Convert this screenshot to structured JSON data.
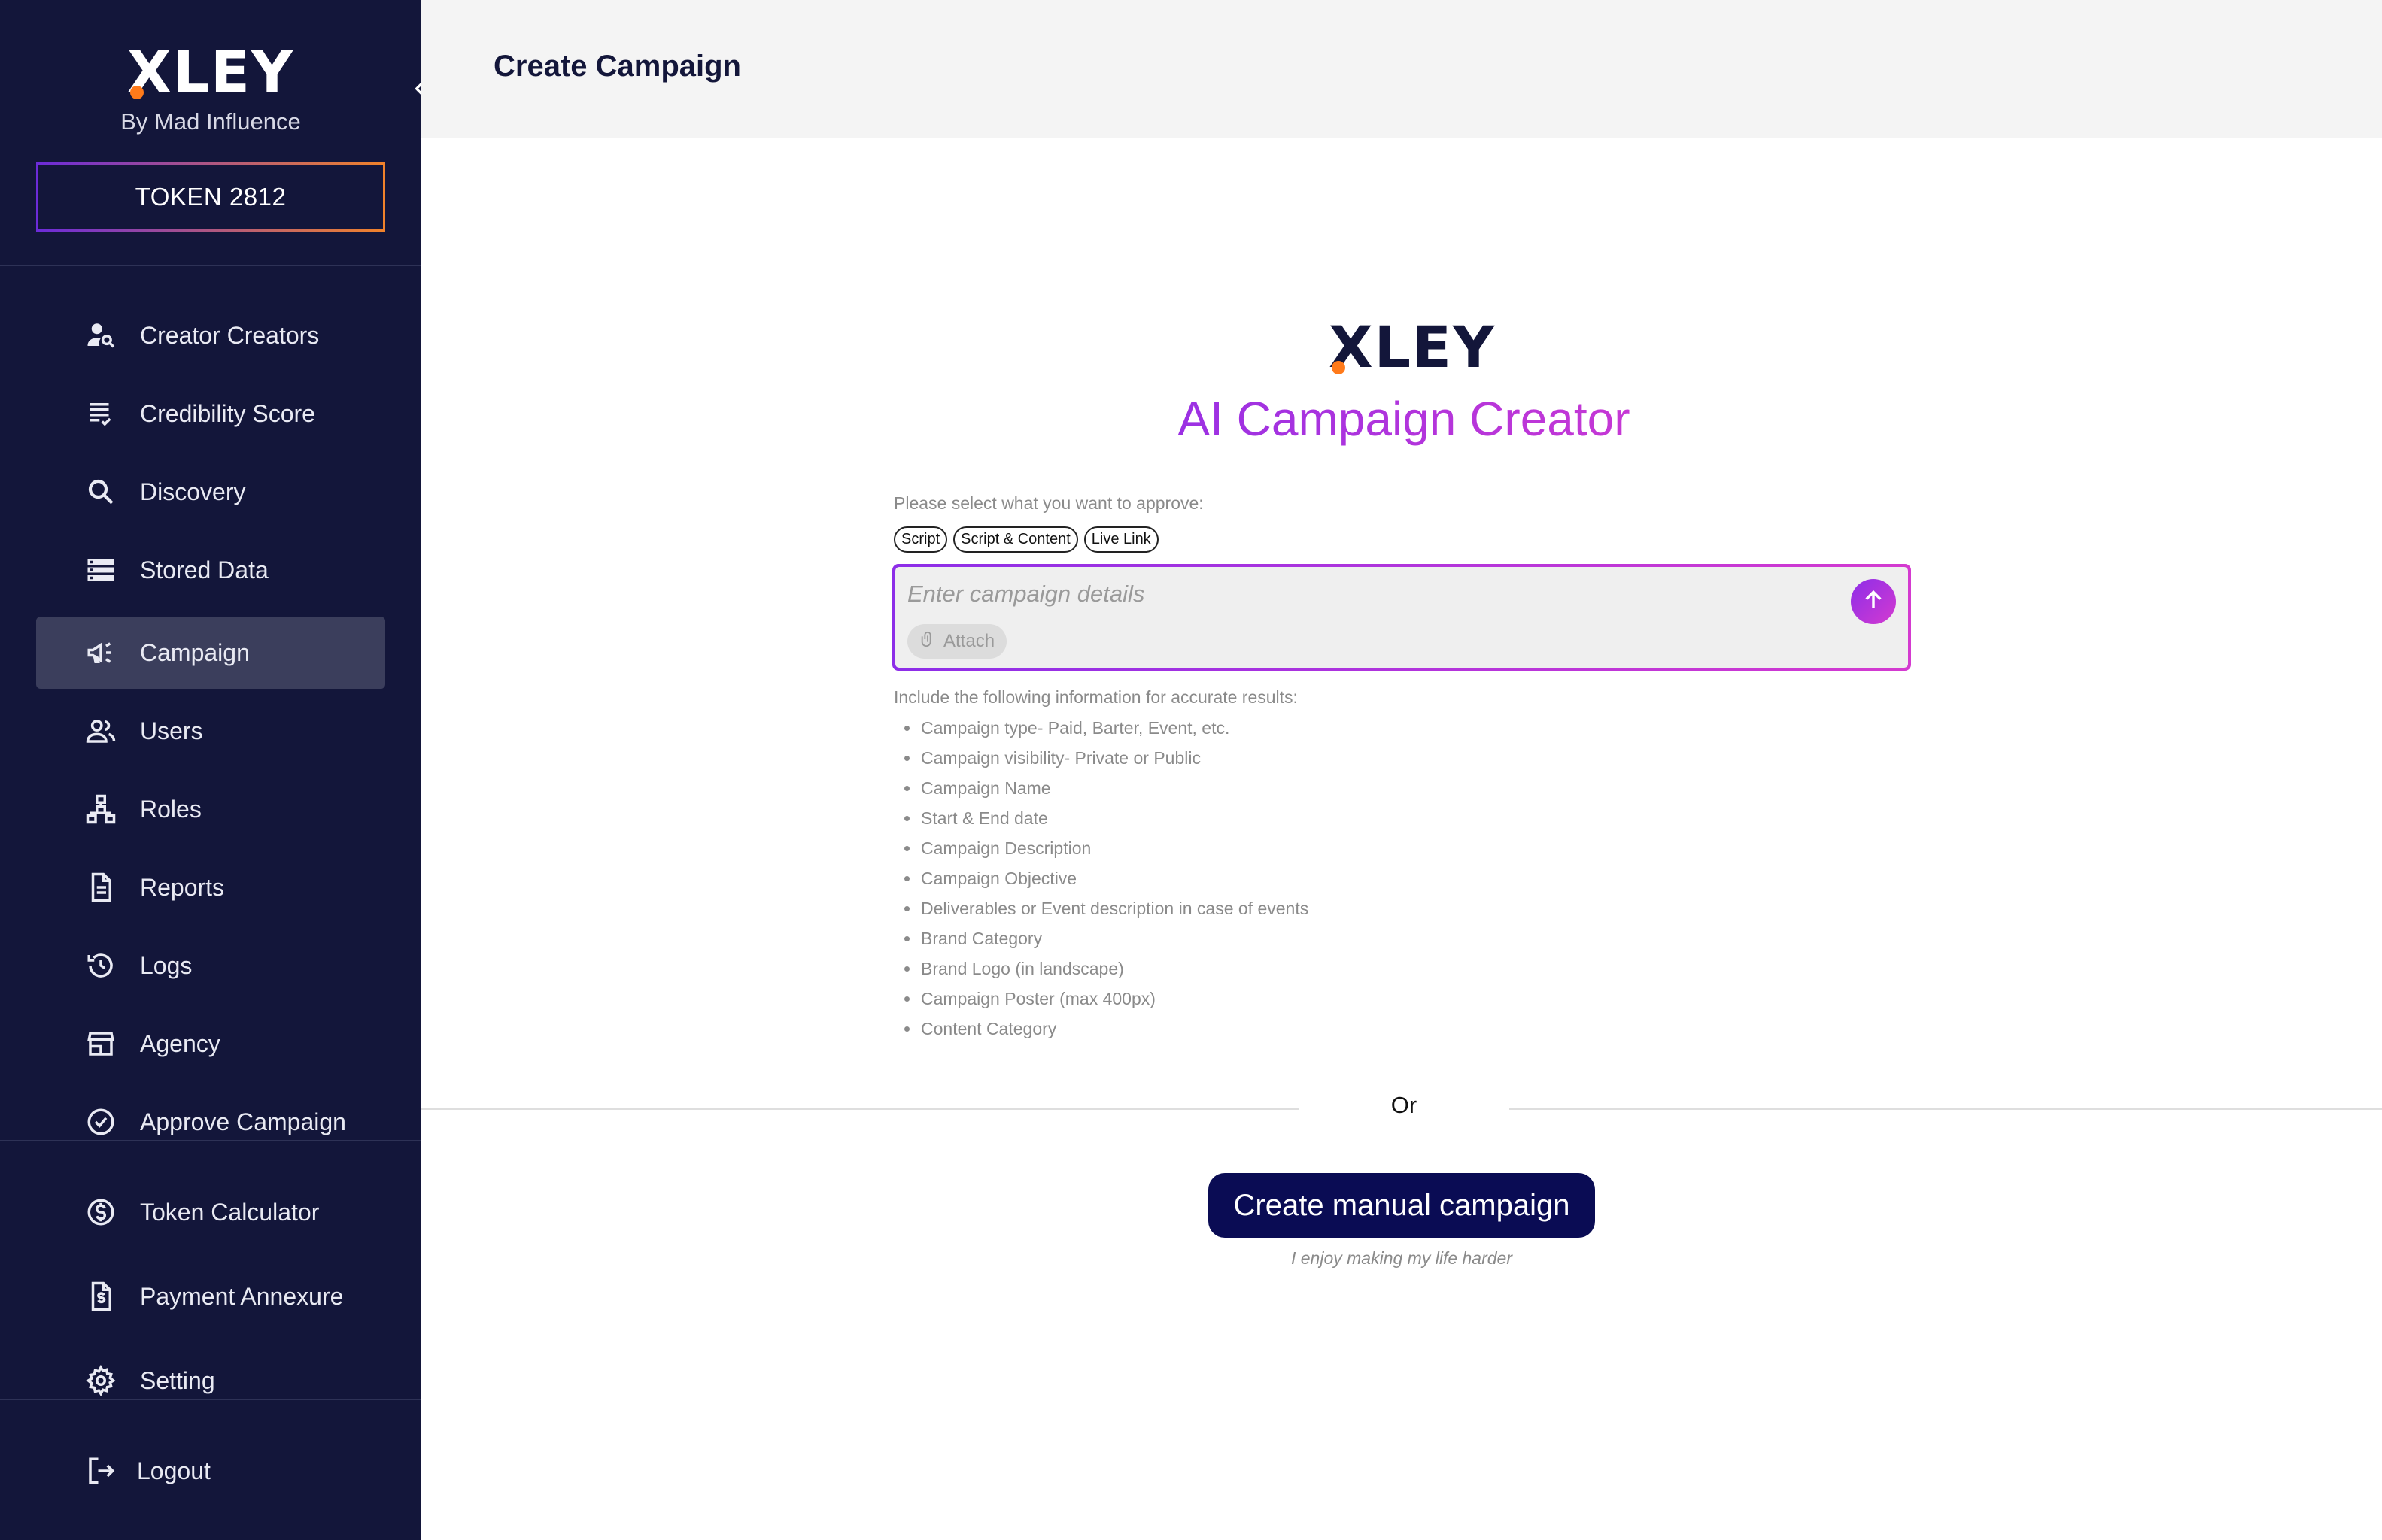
{
  "sidebar": {
    "brand": "XLEY",
    "brand_sub": "By Mad Influence",
    "token": "TOKEN 2812",
    "items": [
      {
        "label": "Creator Creators",
        "icon": "person-search-icon"
      },
      {
        "label": "Credibility Score",
        "icon": "checklist-icon"
      },
      {
        "label": "Discovery",
        "icon": "search-icon"
      },
      {
        "label": "Stored Data",
        "icon": "storage-icon"
      },
      {
        "label": "Campaign",
        "icon": "megaphone-icon",
        "active": true
      },
      {
        "label": "Users",
        "icon": "users-icon"
      },
      {
        "label": "Roles",
        "icon": "hierarchy-icon"
      },
      {
        "label": "Reports",
        "icon": "document-icon"
      },
      {
        "label": "Logs",
        "icon": "history-icon"
      },
      {
        "label": "Agency",
        "icon": "storefront-icon"
      },
      {
        "label": "Approve Campaign",
        "icon": "check-circle-icon"
      }
    ],
    "bottom_items": [
      {
        "label": "Token Calculator",
        "icon": "dollar-circle-icon"
      },
      {
        "label": "Payment Annexure",
        "icon": "invoice-icon"
      },
      {
        "label": "Setting",
        "icon": "gear-icon"
      }
    ],
    "logout": "Logout"
  },
  "header": {
    "title": "Create Campaign"
  },
  "main": {
    "logo": "XLEY",
    "title": "AI Campaign Creator",
    "select_label": "Please select what you want to approve:",
    "chips": [
      "Script",
      "Script & Content",
      "Live Link"
    ],
    "input_placeholder": "Enter campaign details",
    "attach_label": "Attach",
    "include_label": "Include the following information for accurate results:",
    "include_items": [
      "Campaign type- Paid, Barter, Event, etc.",
      "Campaign visibility- Private or Public",
      "Campaign Name",
      "Start & End date",
      "Campaign Description",
      "Campaign Objective",
      "Deliverables or Event description in case of events",
      "Brand Category",
      "Brand Logo (in landscape)",
      "Campaign Poster (max 400px)",
      "Content Category"
    ],
    "or_text": "Or",
    "manual_button": "Create manual campaign",
    "manual_sub": "I enjoy making my life harder"
  },
  "colors": {
    "sidebar_bg": "#13163a",
    "accent_gradient_start": "#8d2ee8",
    "accent_gradient_end": "#d43ad0",
    "primary_button": "#0a0c54",
    "brand_dot": "#ff7a1a"
  }
}
